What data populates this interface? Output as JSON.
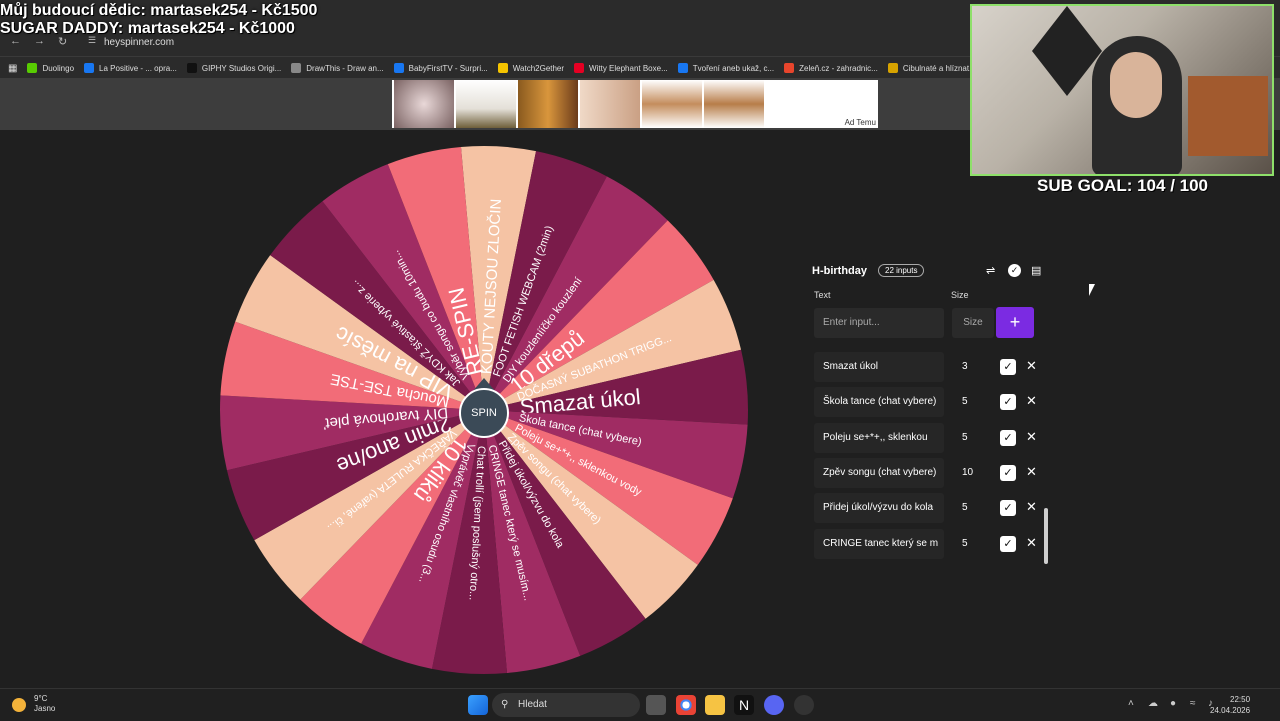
{
  "overlay": {
    "line1": "Můj budoucí dědic: martasek254 - Kč1500",
    "line2": "SUGAR DADDY: martasek254 - Kč1000",
    "sub_goal": "SUB GOAL: 104 / 100"
  },
  "browser": {
    "url": "heyspinner.com",
    "bookmarks": [
      {
        "label": "Duolingo",
        "color": "#58cc02"
      },
      {
        "label": "La Positive - ... opra...",
        "color": "#1877f2"
      },
      {
        "label": "GIPHY Studios Origi...",
        "color": "#111111"
      },
      {
        "label": "DrawThis - Draw an...",
        "color": "#888888"
      },
      {
        "label": "BabyFirstTV - Surpri...",
        "color": "#1877f2"
      },
      {
        "label": "Watch2Gether",
        "color": "#f5c400"
      },
      {
        "label": "Witty Elephant Boxe...",
        "color": "#e60023"
      },
      {
        "label": "Tvoření aneb ukaž, c...",
        "color": "#1877f2"
      },
      {
        "label": "Zeleň.cz - zahradnic...",
        "color": "#e8452c"
      },
      {
        "label": "Cibulnaté a hlíznat...",
        "color": "#d7a300"
      }
    ],
    "ad_label": "Ad Temu"
  },
  "wheel": {
    "spin_label": "SPIN",
    "colors": {
      "dark": "#7a1b4a",
      "mid": "#a02c63",
      "coral": "#f26c78",
      "peach": "#f5c3a4"
    },
    "segments": [
      {
        "label": "KOUTY NEJSOU ZLOČIN",
        "color": "peach"
      },
      {
        "label": "FOOT FETISH WEBCAM (2min)",
        "color": "dark"
      },
      {
        "label": "DIY kouzlenííčko kouzlení",
        "color": "mid"
      },
      {
        "label": "10 dřepů",
        "color": "coral"
      },
      {
        "label": "DOČASNÝ SUBATHON TRIGG...",
        "color": "peach"
      },
      {
        "label": "Smazat úkol",
        "color": "dark"
      },
      {
        "label": "Škola tance (chat vybere)",
        "color": "mid"
      },
      {
        "label": "Poleju se+*+,, sklenkou vody",
        "color": "coral"
      },
      {
        "label": "Zpěv songu (chat vybere)",
        "color": "peach"
      },
      {
        "label": "Přidej úkol/výzvu do kola",
        "color": "dark"
      },
      {
        "label": "CRINGE tanec který se musím...",
        "color": "mid"
      },
      {
        "label": "Chat trollí (jsem poslušný otro...",
        "color": "dark"
      },
      {
        "label": "Vyprávěč vlastního osudu (3...",
        "color": "mid"
      },
      {
        "label": "10 kliků",
        "color": "coral"
      },
      {
        "label": "VAŘEČKA RULETA (vařené, či...",
        "color": "peach"
      },
      {
        "label": "2min ano/ne",
        "color": "dark"
      },
      {
        "label": "DIY tvarohová pleť",
        "color": "mid"
      },
      {
        "label": "Moucha TSE-TSE",
        "color": "coral"
      },
      {
        "label": "VIP na měsíc",
        "color": "peach"
      },
      {
        "label": "Jak KDYŽ šťastivé vyberie z...",
        "color": "dark"
      },
      {
        "label": "Výběr songu co budu 10min...",
        "color": "mid"
      },
      {
        "label": "RE-SPIN",
        "color": "coral"
      }
    ]
  },
  "panel": {
    "title": "H-birthday",
    "badge": "22 inputs",
    "col_text": "Text",
    "col_size": "Size",
    "input_placeholder": "Enter input...",
    "size_placeholder": "Size",
    "add_label": "+",
    "rows": [
      {
        "text": "Smazat úkol",
        "size": "3"
      },
      {
        "text": "Škola tance (chat vybere)",
        "size": "5"
      },
      {
        "text": "Poleju se+*+,, sklenkou",
        "size": "5"
      },
      {
        "text": "Zpěv songu (chat vybere)",
        "size": "10"
      },
      {
        "text": "Přidej úkol/výzvu do kola",
        "size": "5"
      },
      {
        "text": "CRINGE tanec který se m",
        "size": "5"
      }
    ]
  },
  "taskbar": {
    "weather_temp": "9°C",
    "weather_text": "Jasno",
    "search_label": "Hledat",
    "time": "22:50",
    "date": "24.04.2026"
  }
}
